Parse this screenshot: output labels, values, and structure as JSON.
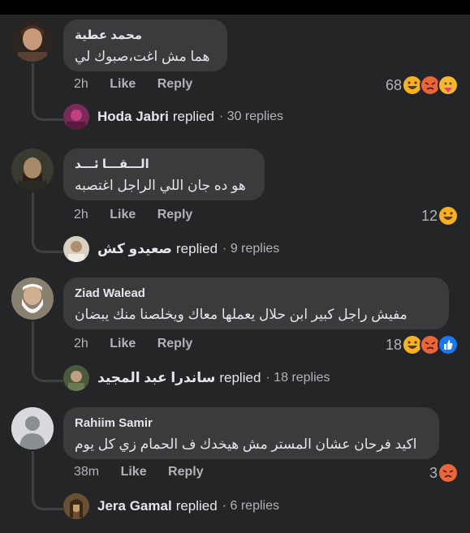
{
  "comments": [
    {
      "name": "محمد عطية",
      "text": "هما مش اغت،صبوك لي",
      "time": "2h",
      "like": "Like",
      "reply": "Reply",
      "reaction_count": "68",
      "reactions": [
        "haha",
        "angry",
        "care"
      ],
      "replier": "Hoda Jabri",
      "replied": "replied",
      "replies": "· 30 replies"
    },
    {
      "name": "الـــقـــا ئـــد",
      "text": "هو ده جان اللي الراجل اغتصبه",
      "time": "2h",
      "like": "Like",
      "reply": "Reply",
      "reaction_count": "12",
      "reactions": [
        "haha"
      ],
      "replier": "صعيدو كش",
      "replied": "replied",
      "replies": "· 9 replies"
    },
    {
      "name": "Ziad Walead",
      "text": "مفيش راجل كبير ابن حلال يعملها معاك ويخلصنا منك يبضان",
      "time": "2h",
      "like": "Like",
      "reply": "Reply",
      "reaction_count": "18",
      "reactions": [
        "haha",
        "angry",
        "like"
      ],
      "replier": "ساندرا عبد المجيد",
      "replied": "replied",
      "replies": "· 18 replies"
    },
    {
      "name": "Rahiim Samir",
      "text": "اكيد فرحان عشان المستر مش هيخدك ف الحمام زي كل يوم",
      "time": "38m",
      "like": "Like",
      "reply": "Reply",
      "reaction_count": "3",
      "reactions": [
        "angry"
      ],
      "replier": "Jera Gamal",
      "replied": "replied",
      "replies": "· 6 replies"
    }
  ]
}
